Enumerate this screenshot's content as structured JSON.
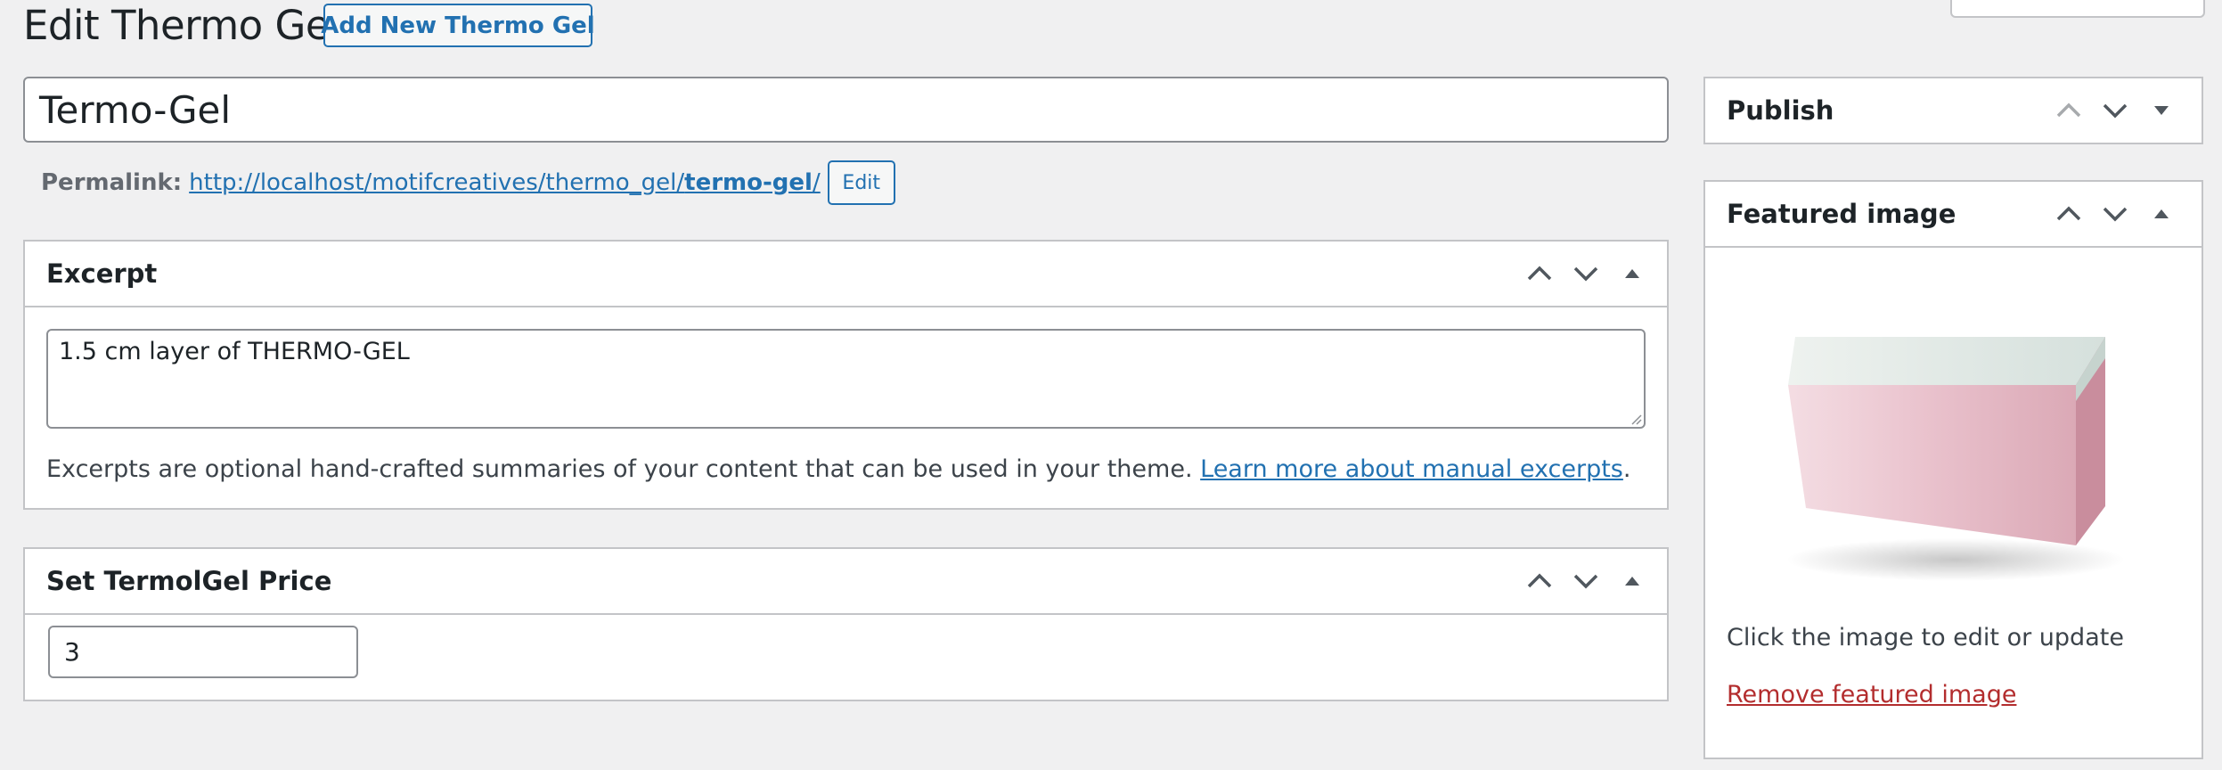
{
  "header": {
    "title": "Edit Thermo Gel",
    "add_new_label": "Add New Thermo Gel"
  },
  "post": {
    "title_value": "Termo-Gel",
    "permalink_label": "Permalink:",
    "permalink_base": "http://localhost/motifcreatives/thermo_gel/",
    "permalink_slug": "termo-gel",
    "permalink_trailing": "/",
    "permalink_edit_label": "Edit"
  },
  "excerpt_box": {
    "title": "Excerpt",
    "value": "1.5 cm layer of THERMO-GEL",
    "help_text": "Excerpts are optional hand-crafted summaries of your content that can be used in your theme.",
    "help_link": "Learn more about manual excerpts",
    "help_end": "."
  },
  "price_box": {
    "title": "Set TermolGel Price",
    "value": "3"
  },
  "sidebar": {
    "publish_title": "Publish",
    "featured_title": "Featured image",
    "featured_caption": "Click the image to edit or update",
    "remove_label": "Remove featured image"
  },
  "icons": {
    "move_up": "chevron-up-icon",
    "move_down": "chevron-down-icon",
    "toggle": "triangle-toggle-icon"
  },
  "colors": {
    "accent": "#2271b1",
    "danger": "#b32d2e",
    "background": "#f0f0f1"
  }
}
